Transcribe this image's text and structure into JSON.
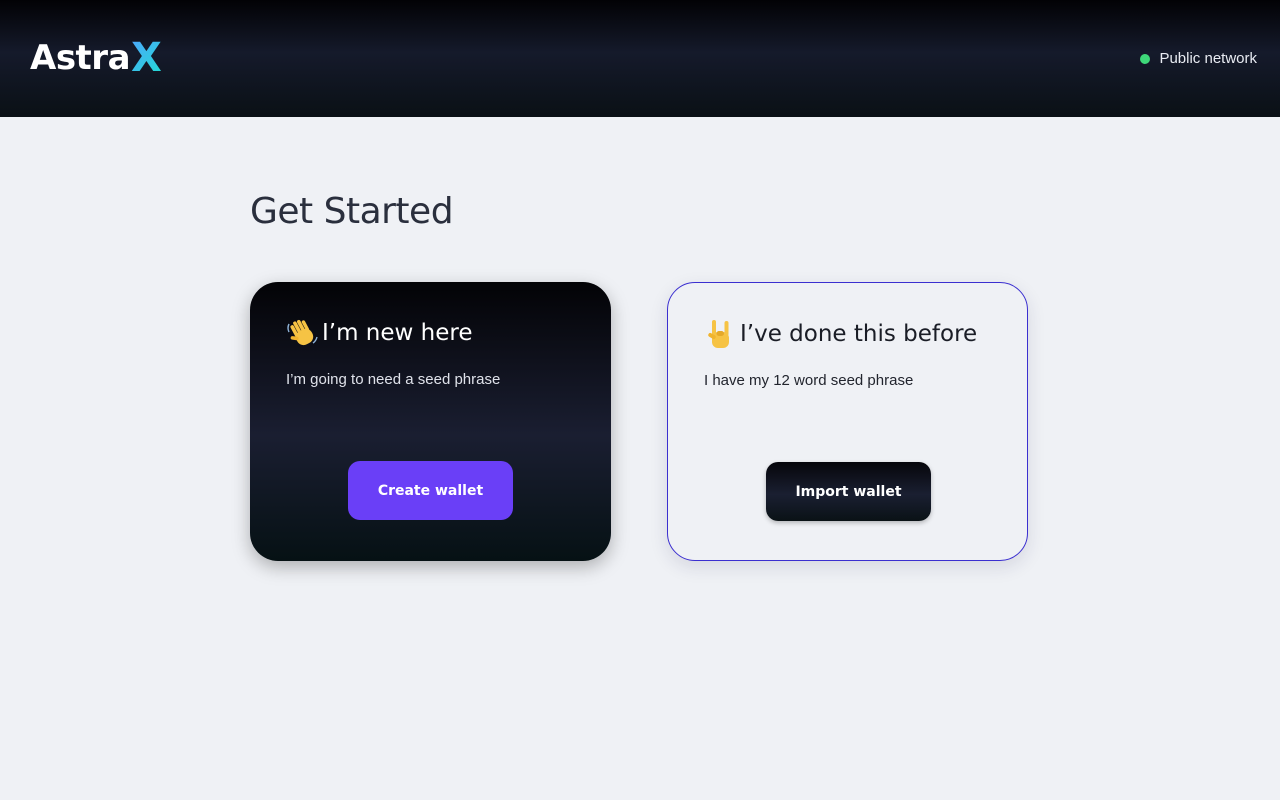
{
  "header": {
    "logo_text": "Astra",
    "logo_accent": "X",
    "network_label": "Public network",
    "network_status_color": "#3ed879"
  },
  "main": {
    "title": "Get Started",
    "cards": [
      {
        "icon": "waving-hand-icon",
        "heading": "I’m new here",
        "description": "I’m going to need a seed phrase",
        "button_label": "Create wallet"
      },
      {
        "icon": "rock-on-hand-icon",
        "heading": "I’ve done this before",
        "description": "I have my 12 word seed phrase",
        "button_label": "Import wallet"
      }
    ]
  },
  "colors": {
    "accent": "#6a3ff7",
    "import_card_border": "#3b2fd0",
    "page_background": "#eff1f5"
  }
}
